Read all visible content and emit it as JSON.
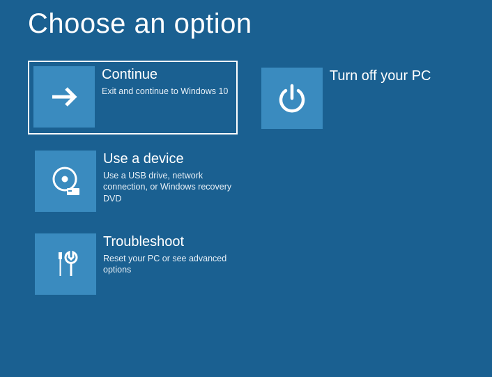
{
  "page_title": "Choose an option",
  "options": {
    "continue": {
      "title": "Continue",
      "desc": "Exit and continue to Windows 10"
    },
    "turn_off": {
      "title": "Turn off your PC",
      "desc": ""
    },
    "use_device": {
      "title": "Use a device",
      "desc": "Use a USB drive, network connection, or Windows recovery DVD"
    },
    "troubleshoot": {
      "title": "Troubleshoot",
      "desc": "Reset your PC or see advanced options"
    }
  }
}
